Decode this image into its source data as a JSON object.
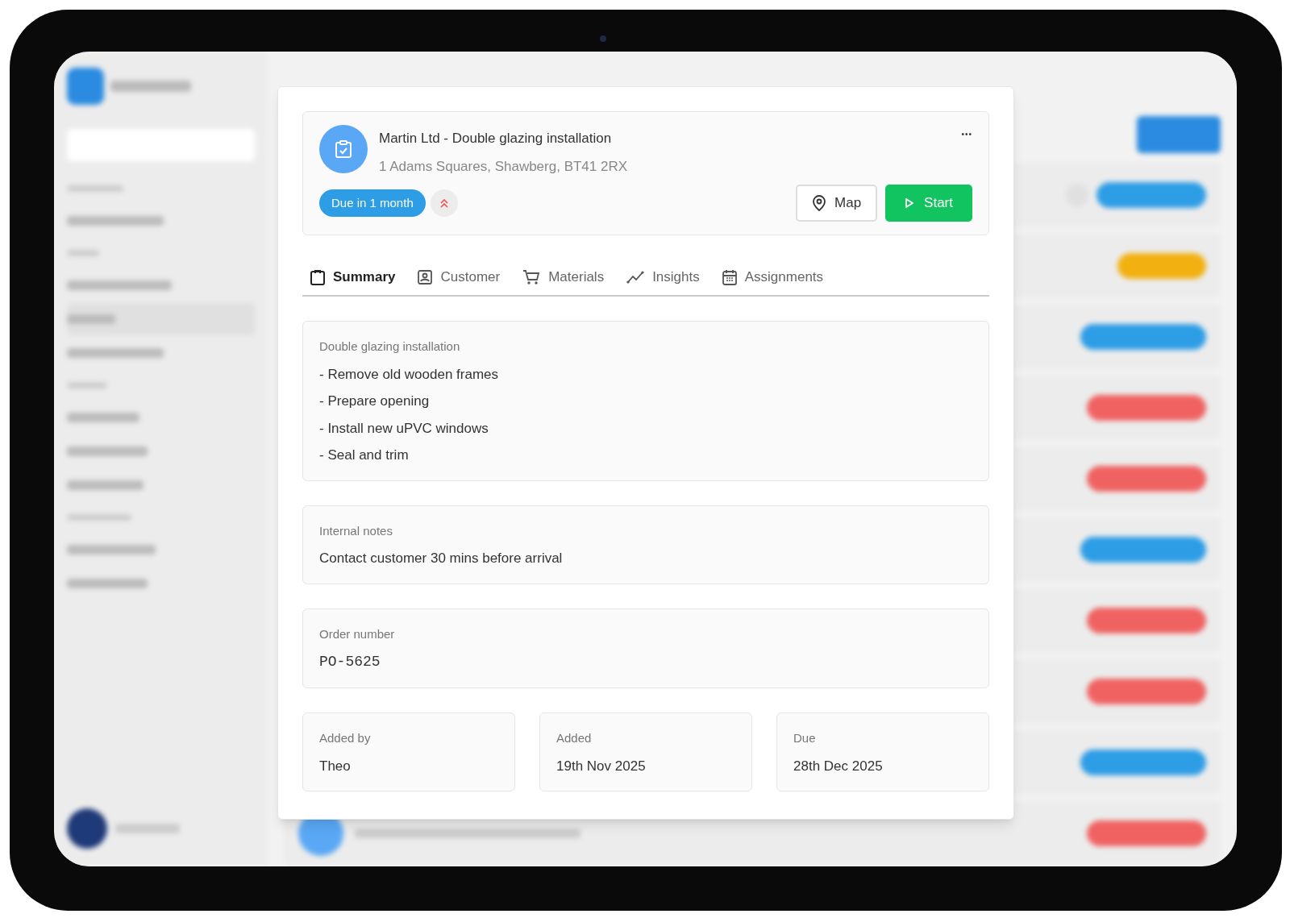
{
  "job_detail": {
    "title": "Martin Ltd - Double glazing installation",
    "address": "1 Adams Squares, Shawberg, BT41 2RX",
    "more": "•••",
    "due_badge": "Due in 1 month",
    "priority": true,
    "buttons": [
      {
        "kind": "map",
        "label": "Map"
      },
      {
        "kind": "start",
        "label": "Start"
      }
    ],
    "tabs": [
      {
        "kind": "summary",
        "label": "Summary",
        "selected": true
      },
      {
        "kind": "customer",
        "label": "Customer",
        "selected": false
      },
      {
        "kind": "materials",
        "label": "Materials",
        "selected": false
      },
      {
        "kind": "insights",
        "label": "Insights",
        "selected": false
      },
      {
        "kind": "assignments",
        "label": "Assignments",
        "selected": false
      }
    ],
    "description": {
      "label": "Double glazing installation",
      "lines": [
        "- Remove old wooden frames",
        "- Prepare opening",
        "- Install new uPVC windows",
        "- Seal and trim"
      ]
    },
    "notes": {
      "label": "Internal notes",
      "value": "Contact customer 30 mins before arrival"
    },
    "order": {
      "label": "Order number",
      "value": "PO-5625"
    },
    "facts": [
      {
        "label": "Added by",
        "value": "Theo"
      },
      {
        "label": "Added",
        "value": "19th Nov 2025"
      },
      {
        "label": "Due",
        "value": "28th Dec 2025"
      }
    ]
  }
}
